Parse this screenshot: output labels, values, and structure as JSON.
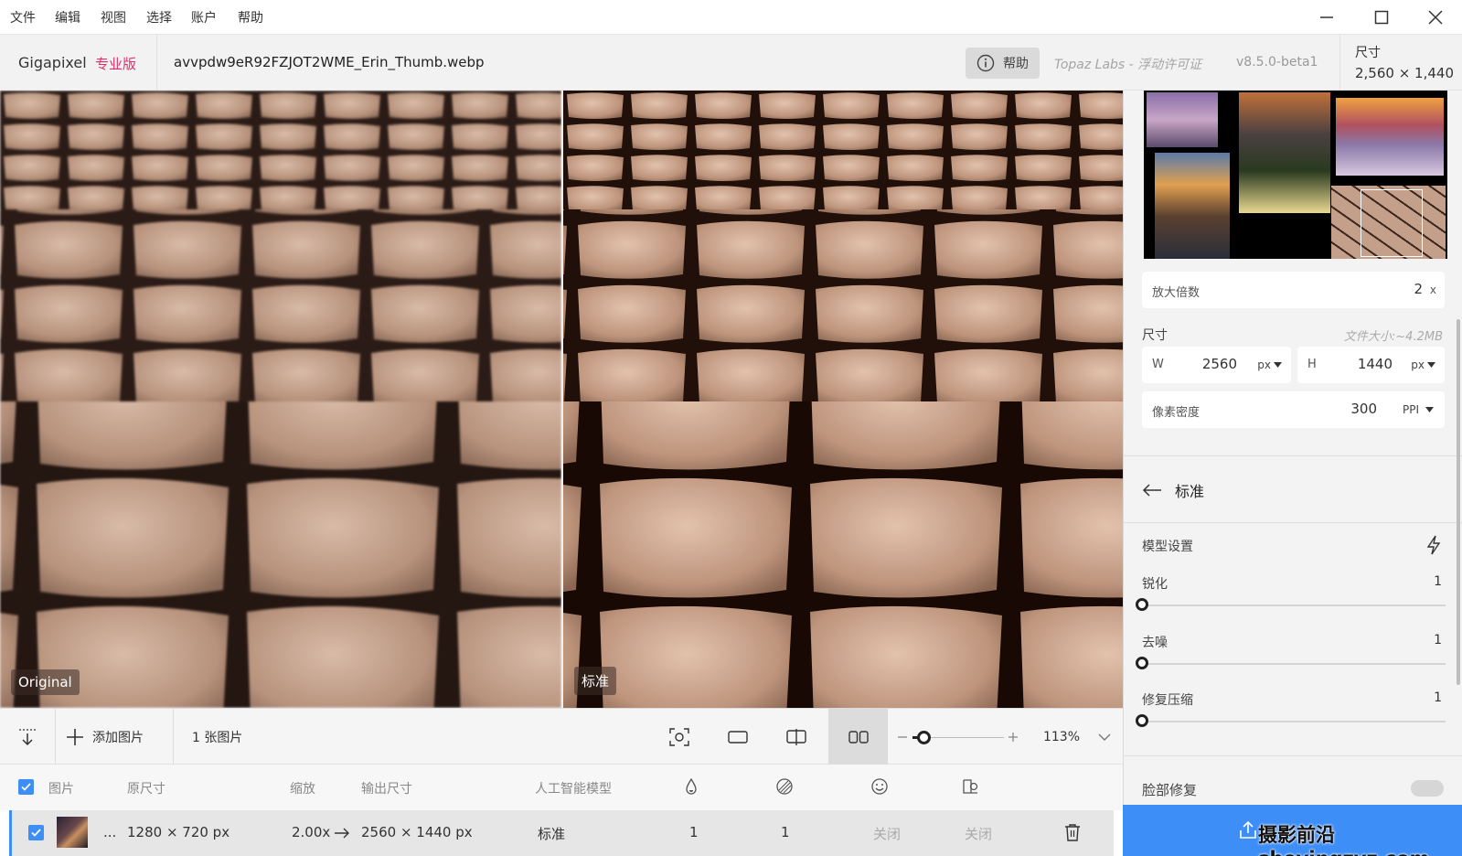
{
  "menu": [
    "文件",
    "编辑",
    "视图",
    "选择",
    "账户",
    "帮助"
  ],
  "header": {
    "brand": "Gigapixel",
    "edition": "专业版",
    "filename": "avvpdw9eR92FZJOT2WME_Erin_Thumb.webp",
    "help_label": "帮助",
    "license": "Topaz Labs - 浮动许可证",
    "version": "v8.5.0-beta1",
    "dim_label": "尺寸",
    "dim_value": "2,560 × 1,440"
  },
  "preview": {
    "left_label": "Original",
    "right_label": "标准"
  },
  "toolbar": {
    "add_images": "添加图片",
    "image_count": "1 张图片",
    "zoom": "113%",
    "zoom_level": 0.12
  },
  "table": {
    "headers": [
      "图片",
      "原尺寸",
      "缩放",
      "输出尺寸",
      "人工智能模型"
    ],
    "row": {
      "ellipsis": "...",
      "original_size": "1280 × 720 px",
      "scale": "2.00x",
      "output_size": "2560 × 1440 px",
      "model": "标准",
      "sharpen": "1",
      "denoise": "1",
      "face": "关闭",
      "color": "关闭"
    }
  },
  "panel": {
    "scale_label": "放大倍数",
    "scale_value": "2",
    "scale_unit": "x",
    "size_label": "尺寸",
    "file_size": "文件大小:~4.2MB",
    "width_label": "W",
    "width_value": "2560",
    "width_unit": "px",
    "height_label": "H",
    "height_value": "1440",
    "height_unit": "px",
    "density_label": "像素密度",
    "density_value": "300",
    "density_unit": "PPI",
    "model_name": "标准",
    "model_settings": "模型设置",
    "sliders": [
      {
        "label": "锐化",
        "value": "1",
        "level": 0
      },
      {
        "label": "去噪",
        "value": "1",
        "level": 0
      },
      {
        "label": "修复压缩",
        "value": "1",
        "level": 0
      }
    ],
    "face_recovery_partial": "脸部修复"
  },
  "colors": {
    "accent": "#3e8ef7",
    "pro": "#e0306a"
  },
  "watermark": "摄影前沿 sheyingzyz.com"
}
